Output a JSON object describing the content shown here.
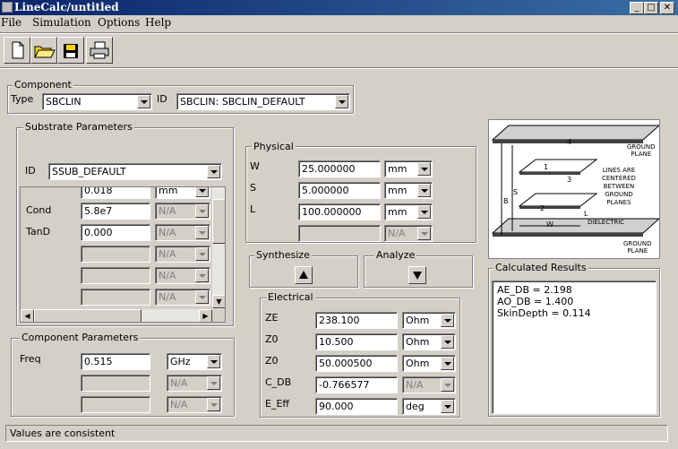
{
  "window": {
    "title": "LineCalc/untitled"
  },
  "menu": [
    "File",
    "Simulation",
    "Options",
    "Help"
  ],
  "toolbar": [
    {
      "name": "new-file",
      "icon": "new-file-icon"
    },
    {
      "name": "open-folder",
      "icon": "open-folder-icon"
    },
    {
      "name": "save",
      "icon": "save-icon"
    },
    {
      "name": "print",
      "icon": "printer-icon"
    }
  ],
  "component": {
    "group_label": "Component",
    "type_label": "Type",
    "type_value": "SBCLIN",
    "id_label": "ID",
    "id_value": "SBCLIN: SBCLIN_DEFAULT"
  },
  "substrate": {
    "group_label": "Substrate Parameters",
    "id_label": "ID",
    "id_value": "SSUB_DEFAULT",
    "rows": [
      {
        "label": "",
        "value": "0.018",
        "unit": "mm",
        "enabled": true
      },
      {
        "label": "Cond",
        "value": "5.8e7",
        "unit": "N/A",
        "enabled": false
      },
      {
        "label": "TanD",
        "value": "0.000",
        "unit": "N/A",
        "enabled": false
      },
      {
        "label": "",
        "value": "",
        "unit": "N/A",
        "enabled": false
      },
      {
        "label": "",
        "value": "",
        "unit": "N/A",
        "enabled": false
      },
      {
        "label": "",
        "value": "",
        "unit": "N/A",
        "enabled": false
      }
    ]
  },
  "component_params": {
    "group_label": "Component Parameters",
    "freq_label": "Freq",
    "freq_value": "0.515",
    "freq_unit": "GHz",
    "unit_na": "N/A"
  },
  "physical": {
    "group_label": "Physical",
    "rows": [
      {
        "label": "W",
        "value": "25.000000",
        "unit": "mm"
      },
      {
        "label": "S",
        "value": "5.000000",
        "unit": "mm"
      },
      {
        "label": "L",
        "value": "100.000000",
        "unit": "mm"
      }
    ],
    "extra_unit": "N/A"
  },
  "synthesize": {
    "label": "Synthesize"
  },
  "analyze": {
    "label": "Analyze"
  },
  "electrical": {
    "group_label": "Electrical",
    "rows": [
      {
        "label": "ZE",
        "value": "238.100",
        "unit": "Ohm",
        "enabled": true
      },
      {
        "label": "Z0",
        "value": "10.500",
        "unit": "Ohm",
        "enabled": true
      },
      {
        "label": "Z0",
        "value": "50.000500",
        "unit": "Ohm",
        "enabled": true
      },
      {
        "label": "C_DB",
        "value": "-0.766577",
        "unit": "N/A",
        "enabled": false
      },
      {
        "label": "E_Eff",
        "value": "90.000",
        "unit": "deg",
        "enabled": true
      }
    ]
  },
  "diagram": {
    "top_label_1": "GROUND",
    "top_label_2": "PLANE",
    "mid_label_1": "LINES ARE",
    "mid_label_2": "CENTERED",
    "mid_label_3": "BETWEEN",
    "mid_label_4": "GROUND",
    "mid_label_5": "PLANES",
    "dielectric": "DIELECTRIC",
    "bot_label_1": "GROUND",
    "bot_label_2": "PLANE",
    "n1": "1",
    "n2": "2",
    "n3": "3",
    "n4": "4",
    "s": "S",
    "b": "B",
    "w": "W",
    "l": "L"
  },
  "results": {
    "group_label": "Calculated Results",
    "lines": [
      "AE_DB = 2.198",
      "AO_DB = 1.400",
      "SkinDepth = 0.114"
    ]
  },
  "status": {
    "text": "Values are consistent"
  }
}
